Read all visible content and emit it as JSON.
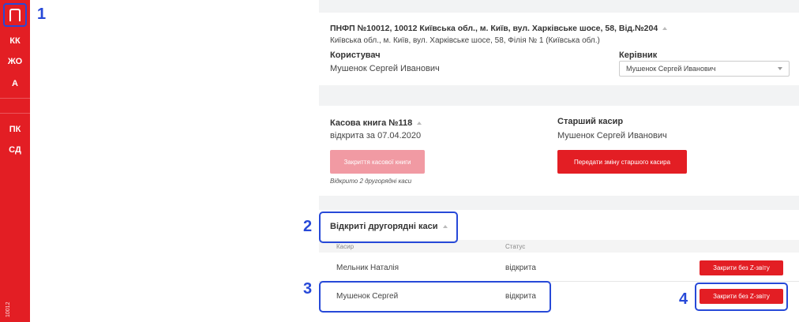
{
  "sidebar": {
    "logo": "logo-icon",
    "items": [
      {
        "label": "КК"
      },
      {
        "label": "ЖО"
      },
      {
        "label": "А"
      },
      {
        "label": "ПК"
      },
      {
        "label": "СД"
      }
    ],
    "footer": "10012"
  },
  "markers": [
    "1",
    "2",
    "3",
    "4"
  ],
  "office": {
    "title": "ПНФП №10012, 10012 Київська обл., м. Київ, вул. Харківське шосе, 58, Від.№204",
    "address": "Київська обл., м. Київ, вул. Харківське шосе, 58, Філія № 1 (Київська обл.)",
    "user_label": "Користувач",
    "user_name": "Мушенок Сергей Иванович",
    "manager_label": "Керівник",
    "manager_value": "Мушенок Сергей Иванович"
  },
  "cashbook": {
    "title": "Касова книга №118",
    "opened": "відкрита за 07.04.2020",
    "close_button": "Закриття касової книги",
    "note": "Відкрито 2 другорядні каси",
    "senior_label": "Старший касир",
    "senior_name": "Мушенок Сергей Иванович",
    "transfer_button": "Передати зміну старшого касира"
  },
  "secondary": {
    "title": "Відкриті другорядні каси",
    "columns": [
      "Касир",
      "Статус"
    ],
    "rows": [
      {
        "cashier": "Мельник Наталія",
        "status": "відкрита",
        "action": "Закрити без Z-звіту"
      },
      {
        "cashier": "Мушенок Сергей",
        "status": "відкрита",
        "action": "Закрити без Z-звіту"
      }
    ]
  },
  "colors": {
    "accent": "#e31e24",
    "highlight": "#2749d8"
  }
}
